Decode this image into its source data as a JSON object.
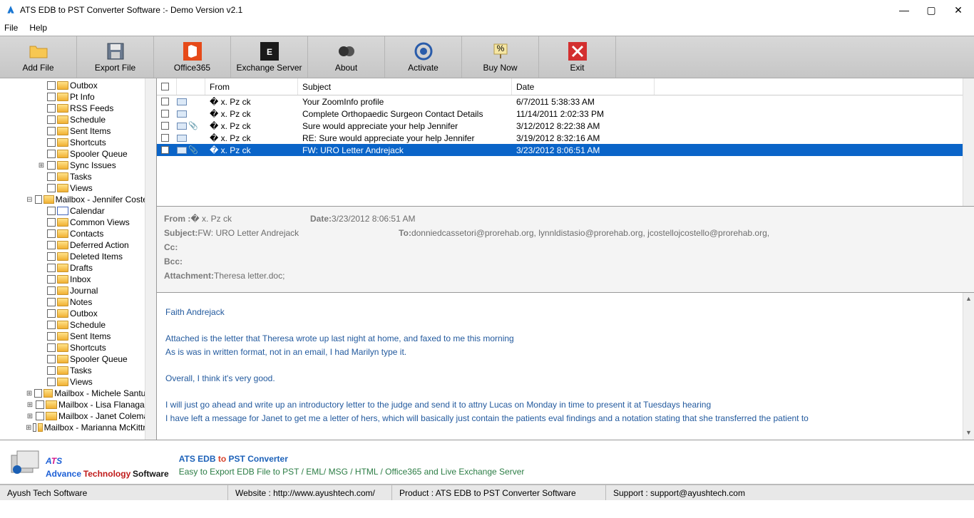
{
  "title": "ATS EDB to PST Converter Software :- Demo Version v2.1",
  "menu": {
    "file": "File",
    "help": "Help"
  },
  "toolbar": [
    {
      "label": "Add File"
    },
    {
      "label": "Export File"
    },
    {
      "label": "Office365"
    },
    {
      "label": "Exchange Server"
    },
    {
      "label": "About"
    },
    {
      "label": "Activate"
    },
    {
      "label": "Buy Now"
    },
    {
      "label": "Exit"
    }
  ],
  "tree_top": [
    "Outbox",
    "Pt Info",
    "RSS Feeds",
    "Schedule",
    "Sent Items",
    "Shortcuts",
    "Spooler Queue",
    "Sync Issues",
    "Tasks",
    "Views"
  ],
  "mailbox1": "Mailbox - Jennifer Costello",
  "tree_mbx1": [
    {
      "l": "Calendar",
      "t": "cal"
    },
    {
      "l": "Common Views",
      "t": "folder"
    },
    {
      "l": "Contacts",
      "t": "folder"
    },
    {
      "l": "Deferred Action",
      "t": "folder"
    },
    {
      "l": "Deleted Items",
      "t": "folder"
    },
    {
      "l": "Drafts",
      "t": "folder"
    },
    {
      "l": "Inbox",
      "t": "folder"
    },
    {
      "l": "Journal",
      "t": "folder"
    },
    {
      "l": "Notes",
      "t": "folder"
    },
    {
      "l": "Outbox",
      "t": "folder"
    },
    {
      "l": "Schedule",
      "t": "folder"
    },
    {
      "l": "Sent Items",
      "t": "folder"
    },
    {
      "l": "Shortcuts",
      "t": "folder"
    },
    {
      "l": "Spooler Queue",
      "t": "folder"
    },
    {
      "l": "Tasks",
      "t": "folder"
    },
    {
      "l": "Views",
      "t": "folder"
    }
  ],
  "mailboxes_more": [
    "Mailbox - Michele Santucci",
    "Mailbox - Lisa Flanagan",
    "Mailbox - Janet Coleman",
    "Mailbox - Marianna McKittrick"
  ],
  "list": {
    "head": {
      "from": "From",
      "subject": "Subject",
      "date": "Date"
    },
    "rows": [
      {
        "from": "� x. Pz ck",
        "subject": "Your ZoomInfo profile",
        "date": "6/7/2011 5:38:33 AM",
        "att": false
      },
      {
        "from": "� x. Pz ck",
        "subject": "Complete Orthopaedic Surgeon Contact Details",
        "date": "11/14/2011 2:02:33 PM",
        "att": false
      },
      {
        "from": "� x. Pz ck",
        "subject": "Sure would appreciate your help Jennifer",
        "date": "3/12/2012 8:22:38 AM",
        "att": true
      },
      {
        "from": "� x. Pz ck",
        "subject": "RE: Sure would appreciate your help Jennifer",
        "date": "3/19/2012 8:32:16 AM",
        "att": false
      },
      {
        "from": "� x. Pz ck",
        "subject": "FW: URO Letter Andrejack",
        "date": "3/23/2012 8:06:51 AM",
        "att": true,
        "sel": true
      }
    ]
  },
  "preview": {
    "from_lbl": "From :",
    "from": "� x. Pz ck",
    "date_lbl": "Date:",
    "date": "3/23/2012 8:06:51 AM",
    "subj_lbl": "Subject:",
    "subj": " FW: URO Letter Andrejack",
    "to_lbl": "To:",
    "to": " donniedcassetori@prorehab.org, lynnldistasio@prorehab.org, jcostellojcostello@prorehab.org,",
    "cc_lbl": "Cc:",
    "bcc_lbl": "Bcc:",
    "att_lbl": "Attachment:",
    "att": " Theresa letter.doc;",
    "body": [
      "Faith Andrejack",
      "",
      "Attached is the letter that Theresa wrote up last night at home, and faxed to me this morning",
      "As is was in written format, not in an email, I had Marilyn type it.",
      "",
      "Overall, I think it's very good.",
      "",
      "I will just go ahead and write up an introductory letter to the judge and send it to attny Lucas on Monday in time to present it at Tuesdays hearing",
      "I have left a message for Janet to get me a letter of hers, which will basically just contain the patients eval findings and a notation stating that she transferred the patient to"
    ]
  },
  "brand": {
    "heading_a": "ATS EDB ",
    "heading_b": "to",
    "heading_c": " PST Converter",
    "tagline": "Easy to Export EDB File to PST / EML/ MSG / HTML / Office365 and Live Exchange Server",
    "logo_a": "A",
    "logo_t": "T",
    "logo_s": "S",
    "logo_sub": "Advance Technology Software"
  },
  "status": {
    "company": "Ayush Tech Software",
    "website": "Website : http://www.ayushtech.com/",
    "product": "Product : ATS EDB to PST Converter Software",
    "support": "Support : support@ayushtech.com"
  }
}
